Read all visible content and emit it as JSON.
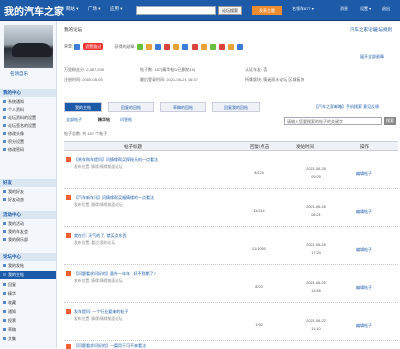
{
  "header": {
    "logo": "我的汽车之家",
    "nav": [
      "网站 ▾",
      "广场 ▾",
      "应用 ▾"
    ],
    "search_placeholder": "",
    "search_button": "论坛搜索",
    "post_button": "发表主题",
    "user": "名领车677 ▾",
    "notifications": "消息",
    "settings": "设置 ▾",
    "logout": "退出"
  },
  "sidebar": {
    "username": "名领自乐",
    "sections": [
      {
        "title": "我的中心",
        "items": [
          "系统通知",
          "个人资料",
          "论坛资料的设置",
          "论坛签名的设置",
          "修改头像",
          "积分设置",
          "修改密码"
        ]
      },
      {
        "title": "好友",
        "items": [
          "我的好友",
          "好友动态"
        ]
      },
      {
        "title": "活动中心",
        "items": [
          "我的活动",
          "我的车友会",
          "我的俱乐部"
        ]
      },
      {
        "title": "论坛中心",
        "items": [
          "我的发帖",
          "我的主帖",
          "回复",
          "精华",
          "收藏",
          "通知",
          "投票",
          "草稿",
          "文集"
        ]
      }
    ]
  },
  "main": {
    "breadcrumb": "我的论坛",
    "links": [
      "汽车之家论坛",
      "论坛规则"
    ],
    "medals_label": "荣誉:",
    "medal_badge": "武警路过",
    "pulled_label": "获得的勋章:",
    "all_medals_link": "展开全部勋章",
    "info": [
      {
        "label": "万里粉丝分:",
        "value": "2,387,539"
      },
      {
        "label": "帖子数:",
        "value": "187(精华帖0/已删帖10)"
      },
      {
        "label": "认证车友:",
        "value": "否"
      },
      {
        "label": "注册时间:",
        "value": "2000-05-05"
      },
      {
        "label": "最后登录时间:",
        "value": "2021-05-21 16:37"
      },
      {
        "label": "所属版块:",
        "value": "情迷丽水论坛 区域板块"
      }
    ],
    "tabs": [
      "我的主帖",
      "回复的回帖",
      "草稿的回帖",
      "回复我的回帖"
    ],
    "right_links": "【汽车之家邮箱】手机搜索  意见反馈",
    "subtabs": [
      "全部帖子",
      "精华帖",
      "问答帖"
    ],
    "search_placeholder": "请输入您要搜索的帖子的关键字",
    "search_button": "搜索",
    "count_text": "帖子总数: 共 187 个帖子",
    "table_headers": [
      "帖子标题",
      "回复/点击",
      "发帖时间",
      "操作"
    ],
    "rows": [
      {
        "title": "【贵车购车提问】问情缘帮买探秘天的一点看法",
        "forum": "发布位置: 情缘/情缘前面论坛",
        "stats": "8/124",
        "date": "2021-06-28",
        "time": "09:25",
        "action": "编辑帖子"
      },
      {
        "title": "【汽车新车讯】问情缘帮买福情缘的一点看法",
        "forum": "发布位置: 情缘/情缘前面论坛",
        "stats": "11/214",
        "date": "2021-06-28",
        "time": "08:21",
        "action": "编辑帖子"
      },
      {
        "title": "就在打: 天气的了, 就买点东西",
        "forum": "发布位置: 看过/我的论坛",
        "stats": "21/1090",
        "date": "2021-06-28",
        "time": "17:24",
        "action": "编辑帖子"
      },
      {
        "title": "【问题看求问好的】意外一年年 · 好不到期了?",
        "forum": "发布位置: 情缘/情缘前面论坛",
        "stats": "8/20",
        "date": "2021-06-26",
        "time": "13:46",
        "action": "编辑帖子"
      },
      {
        "title": "发车提问: 一个行业要来的帖子",
        "forum": "发布位置: 情缘/情缘前面论坛",
        "stats": "1/90",
        "date": "2021-06-22",
        "time": "11:10",
        "action": "编辑帖子"
      },
      {
        "title": "【问题看求问好的】一篇用于可不来看法",
        "forum": "发布位置: 情缘/情缘前面论坛",
        "stats": "",
        "date": "",
        "time": "",
        "action": ""
      }
    ]
  }
}
